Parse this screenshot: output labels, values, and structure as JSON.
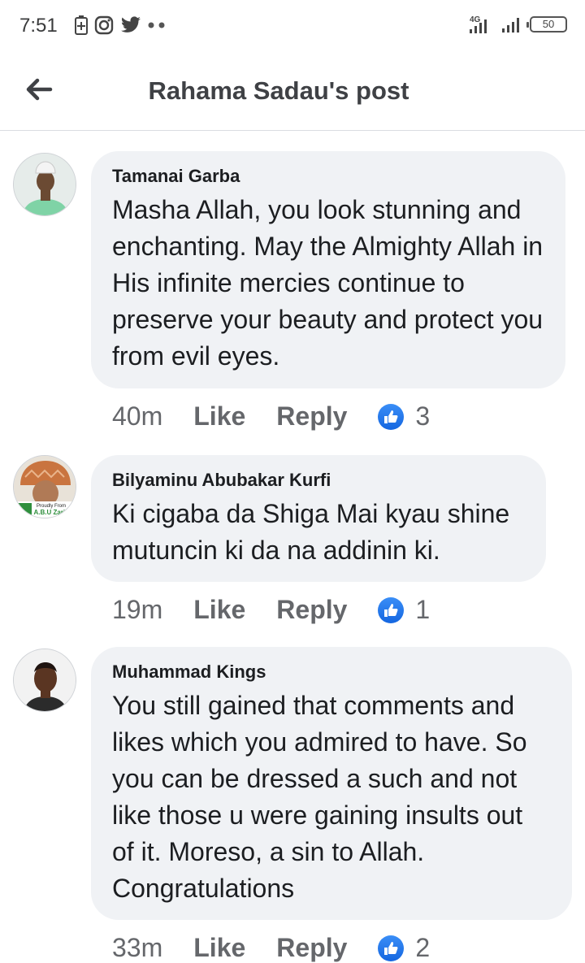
{
  "status_bar": {
    "time": "7:51",
    "network": "4G",
    "battery": "50"
  },
  "header": {
    "title": "Rahama Sadau's post"
  },
  "comments": [
    {
      "author": "Tamanai Garba",
      "text": "Masha Allah, you look stunning and enchanting. May the Almighty Allah in His infinite mercies continue to preserve your beauty and protect you from evil eyes.",
      "time": "40m",
      "like": "Like",
      "reply": "Reply",
      "reactions": "3"
    },
    {
      "author": "Bilyaminu Abubakar Kurfi",
      "text": "Ki cigaba da Shiga Mai kyau shine mutuncin ki da na addinin ki.",
      "time": "19m",
      "like": "Like",
      "reply": "Reply",
      "reactions": "1",
      "avatar_caption": "Proudly From A.B.U Zaria"
    },
    {
      "author": "Muhammad Kings",
      "text": "You still gained that comments and likes which you admired to have. So you can be dressed a such and not like those u were gaining insults out of it. Moreso, a sin to Allah. Congratulations",
      "time": "33m",
      "like": "Like",
      "reply": "Reply",
      "reactions": "2"
    }
  ],
  "colors": {
    "like_blue": "#1877f2",
    "bubble": "#f0f2f5",
    "meta": "#65676b"
  }
}
